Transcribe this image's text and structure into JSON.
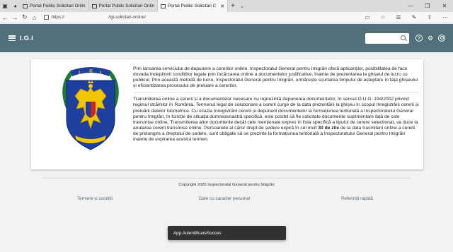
{
  "browser": {
    "tabs": [
      {
        "label": "Portal Public Solicitari Onlin",
        "active": false
      },
      {
        "label": "Portal Public Solicitari Onlin",
        "active": false
      },
      {
        "label": "Portal Public Solicitari C",
        "active": true
      }
    ],
    "url_scheme": "https://",
    "url_path": "/igi-solicitari-online/"
  },
  "app": {
    "title": "I.G.I",
    "search_placeholder": "",
    "header_color": "#52707c"
  },
  "crest": {
    "ribbon_letters": [
      "I",
      "G",
      "I"
    ]
  },
  "content": {
    "paragraph1": "Prin lansarea serviciului de depunere a cererilor online, Inspectoratul General pentru Imigrări oferă aplicanților, posibilitatea de face dovada îndeplinirii condițiilor legale prin încărcarea online a documentelor justificative, înainte de prezentarea la ghișeul de lucru cu publicul. Prin această metodă de lucru, Inspectoratul General pentru Imigrări, urmărește scurtarea timpului de așteptare în fața ghișeului și eficientizarea procesului de preluare a cererilor.",
    "paragraph2_before": "Transmiterea online a cererii și a documentelor necesare nu reprezintă depunerea documentelor, în sensul O.U.G. 194/2002 privind regimul străinilor în România. Termenul legal de soluționare a cererii curge de la data prezentării la ghișeu în scopul înregistrării cererii și preluării datelor biometrice. Cu ocazia înregistrării cererii și depunerii documentelor la formațiunea teritorială a Inspectoratului General pentru Imigrări, în funcție de situația dumneavoastră specifică, este posibil să fie solicitate documente suplimentare față de cele transmise online. Transmiterea altor documente decât cele menționate expres în lista specifică a tipului de cerere selectionat, va duce la anularea cererii transmise online. Persoanele al căror drept de ședere expiră în cel mult ",
    "paragraph2_bold": "30 de zile",
    "paragraph2_after": " de la data trasmiterii online a cererii de prelungire a dreptului de ședere, sunt obligate să se prezinte la formațiunea teritorială a Inspectoratului General pentru Imigrări înainte de expirarea acestui termen."
  },
  "footer": {
    "copyright": "Copyright 2020 Inspectoratul General pentru Imigrări",
    "links": [
      "Termeni și condiții",
      "Date cu caracter personal",
      "Referință rapidă"
    ]
  },
  "toast": {
    "message": "App.AutentificareSucces"
  }
}
